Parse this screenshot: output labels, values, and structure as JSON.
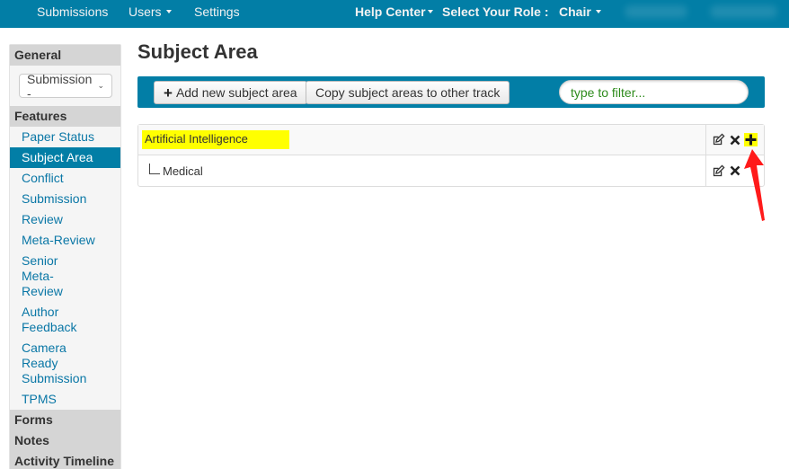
{
  "topbar": {
    "submissions": "Submissions",
    "users": "Users",
    "settings": "Settings",
    "help_center": "Help Center",
    "select_role_label": "Select Your Role :",
    "role": "Chair"
  },
  "sidebar": {
    "general_header": "General",
    "select_value": "Submission -",
    "features_header": "Features",
    "items": [
      {
        "label": "Paper Status",
        "active": false
      },
      {
        "label": "Subject Area",
        "active": true
      },
      {
        "label": "Conflict",
        "active": false
      },
      {
        "label": "Submission",
        "active": false
      },
      {
        "label": "Review",
        "active": false
      },
      {
        "label": "Meta-Review",
        "active": false
      },
      {
        "label": "Senior Meta-Review",
        "active": false
      },
      {
        "label": "Author Feedback",
        "active": false
      },
      {
        "label": "Camera Ready Submission",
        "active": false
      },
      {
        "label": "TPMS",
        "active": false
      }
    ],
    "forms_header": "Forms",
    "notes_header": "Notes",
    "activity_header": "Activity Timeline"
  },
  "main": {
    "title": "Subject Area",
    "add_button": "Add new subject area",
    "copy_button": "Copy subject areas to other track",
    "filter_placeholder": "type to filter...",
    "subject_areas": [
      {
        "name": "Artificial Intelligence",
        "level": 0,
        "highlighted": true,
        "actions": [
          "edit",
          "delete",
          "add-child"
        ]
      },
      {
        "name": "Medical",
        "level": 1,
        "highlighted": false,
        "actions": [
          "edit",
          "delete"
        ]
      }
    ]
  },
  "colors": {
    "brand": "#027ea6",
    "highlight": "#ffff00",
    "annotation_arrow": "#ff1a1a",
    "link": "#0a77a6",
    "placeholder": "#2e8b1c"
  }
}
